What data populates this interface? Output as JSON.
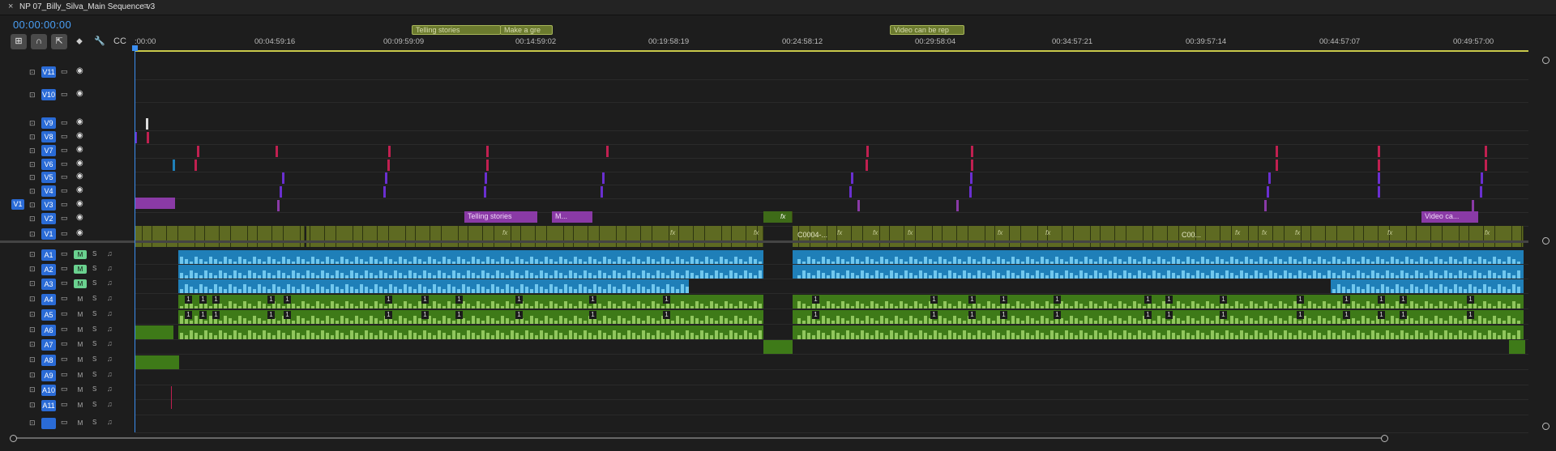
{
  "header": {
    "close_icon": "close-icon",
    "title": "NP 07_Billy_Silva_Main Sequence v3",
    "menu_icon": "hamburger-menu-icon"
  },
  "timecode": "00:00:00:00",
  "tools": [
    {
      "name": "nest-sequences-tool",
      "glyph": "⊞",
      "on": true
    },
    {
      "name": "snap-tool",
      "glyph": "∩",
      "on": true
    },
    {
      "name": "linked-selection-tool",
      "glyph": "⇱",
      "on": true
    },
    {
      "name": "add-marker-tool",
      "glyph": "⬥",
      "on": false
    },
    {
      "name": "timeline-settings-tool",
      "glyph": "🔧",
      "on": false
    },
    {
      "name": "captions-tool",
      "glyph": "CC",
      "on": false
    }
  ],
  "ruler": {
    "ticks": [
      ":00:00",
      "00:04:59:16",
      "00:09:59:09",
      "00:14:59:02",
      "00:19:58:19",
      "00:24:58:12",
      "00:29:58:04",
      "00:34:57:21",
      "00:39:57:14",
      "00:44:57:07",
      "00:49:57:00"
    ],
    "markers": [
      "Telling stories",
      "Make a gre",
      "Video can be rep"
    ]
  },
  "video_tracks": [
    {
      "name": "V11"
    },
    {
      "name": "V10"
    },
    {
      "name": "V9"
    },
    {
      "name": "V8"
    },
    {
      "name": "V7"
    },
    {
      "name": "V6"
    },
    {
      "name": "V5"
    },
    {
      "name": "V4"
    },
    {
      "name": "V3",
      "source": "V1"
    },
    {
      "name": "V2"
    },
    {
      "name": "V1"
    }
  ],
  "audio_tracks": [
    {
      "name": "A1",
      "mute": "M",
      "solo": "S",
      "m_on": true
    },
    {
      "name": "A2",
      "mute": "M",
      "solo": "S",
      "m_on": true
    },
    {
      "name": "A3",
      "mute": "M",
      "solo": "S",
      "m_on": true
    },
    {
      "name": "A4",
      "mute": "M",
      "solo": "S",
      "m_on": false
    },
    {
      "name": "A5",
      "mute": "M",
      "solo": "S",
      "m_on": false
    },
    {
      "name": "A6",
      "mute": "M",
      "solo": "S",
      "m_on": false
    },
    {
      "name": "A7",
      "mute": "M",
      "solo": "S",
      "m_on": false
    },
    {
      "name": "A8",
      "mute": "M",
      "solo": "S",
      "m_on": false
    },
    {
      "name": "A9",
      "mute": "M",
      "solo": "S",
      "m_on": false
    },
    {
      "name": "A10",
      "mute": "M",
      "solo": "S",
      "m_on": false
    },
    {
      "name": "A11",
      "mute": "M",
      "solo": "S",
      "m_on": false
    },
    {
      "name": "",
      "mute": "M",
      "solo": "S",
      "m_on": false
    }
  ],
  "clips": {
    "titles": [
      "Telling stories",
      "M...",
      "Video ca..."
    ],
    "v1": [
      "C0004-...",
      "C00..."
    ],
    "fx_label": "fx",
    "audio_badge": "1"
  },
  "colors": {
    "accent": "#3b8ef0",
    "video_clip": "#5e6a22",
    "title_clip": "#8a3aa6",
    "audio_blue": "#1f7fb8",
    "audio_green": "#3e7a18"
  }
}
